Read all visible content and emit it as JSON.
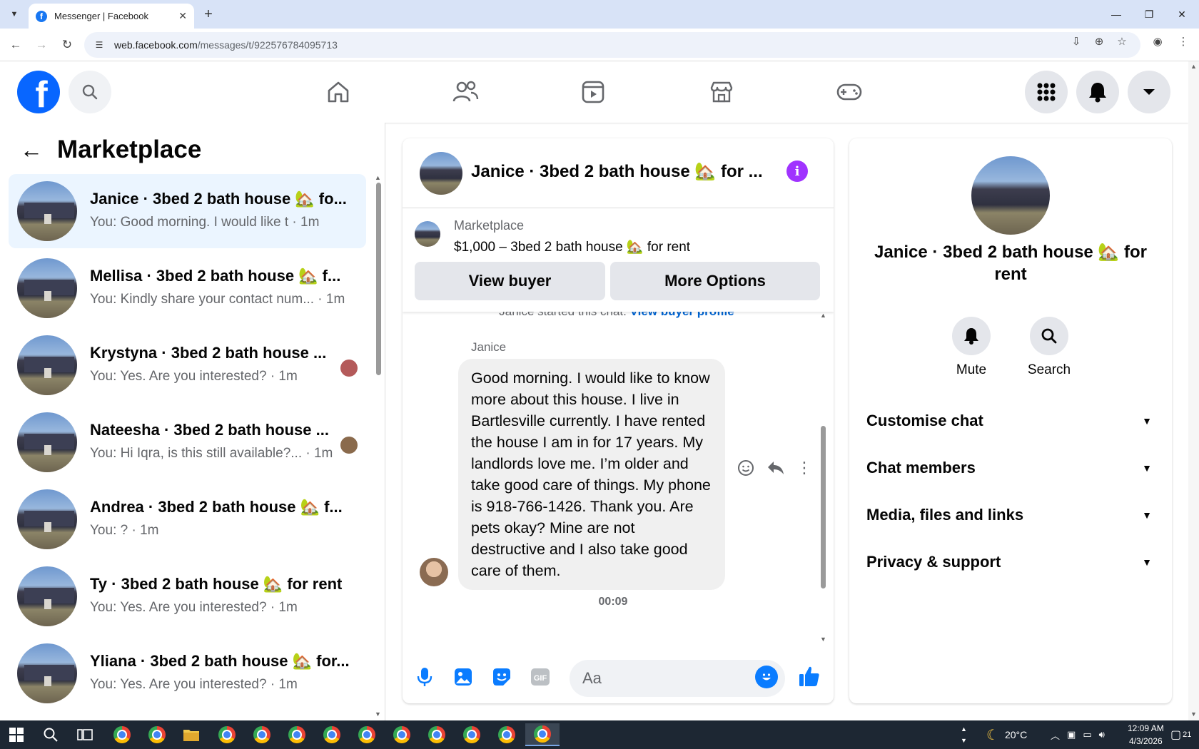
{
  "browser": {
    "tab_title": "Messenger | Facebook",
    "url_host": "web.facebook.com",
    "url_path": "/messages/t/922576784095713"
  },
  "left_panel": {
    "title": "Marketplace",
    "conversations": [
      {
        "name": "Janice · 3bed 2 bath house 🏡 fo...",
        "snippet": "You: Good morning. I would like t · 1m",
        "active": true
      },
      {
        "name": "Mellisa · 3bed 2 bath house 🏡 f...",
        "snippet": "You: Kindly share your contact num... · 1m"
      },
      {
        "name": "Krystyna · 3bed 2 bath house ...",
        "snippet": "You: Yes. Are you interested? · 1m"
      },
      {
        "name": "Nateesha · 3bed 2 bath house ...",
        "snippet": "You: Hi Iqra, is this still available?... · 1m"
      },
      {
        "name": "Andrea · 3bed 2 bath house 🏡 f...",
        "snippet": "You: ? · 1m"
      },
      {
        "name": "Ty · 3bed 2 bath house 🏡 for rent",
        "snippet": "You: Yes. Are you interested? · 1m"
      },
      {
        "name": "Yliana · 3bed 2 bath house 🏡 for...",
        "snippet": "You: Yes. Are you interested? · 1m"
      }
    ]
  },
  "chat": {
    "title": "Janice · 3bed 2 bath house 🏡 for ...",
    "listing_label": "Marketplace",
    "listing_desc": "$1,000 – 3bed 2 bath house 🏡 for rent",
    "view_buyer": "View buyer",
    "more_options": "More Options",
    "started_text": "Janice started this chat.",
    "view_buyer_profile": "View buyer profile",
    "sender": "Janice",
    "message": "Good morning.  I would like to know more about this house.  I live in Bartlesville currently. I have rented the house I am in for 17 years.  My landlords love me. I’m older and take good care of things. My phone is 918-766-1426.  Thank you.  Are pets okay? Mine are not destructive and I also take good care of them.",
    "timestamp": "00:09",
    "composer_placeholder": "Aa"
  },
  "right_panel": {
    "title": "Janice · 3bed 2 bath house 🏡 for rent",
    "mute": "Mute",
    "search": "Search",
    "sections": [
      "Customise chat",
      "Chat members",
      "Media, files and links",
      "Privacy & support"
    ]
  },
  "taskbar": {
    "temperature": "20°C",
    "time": "12:09 AM",
    "date": "4/3/2026",
    "notifications": "21"
  },
  "colors": {
    "facebook_blue": "#0866ff",
    "messenger_blue": "#0a7cff",
    "info_purple": "#a033ff",
    "active_conv": "#ebf5ff"
  }
}
